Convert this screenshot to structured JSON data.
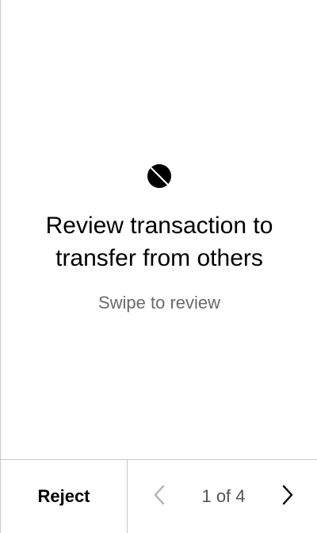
{
  "review": {
    "logo_icon": "ontology-logo-icon",
    "title": "Review transaction to transfer from others",
    "subtitle": "Swipe to review"
  },
  "footer": {
    "reject_label": "Reject",
    "pagination": {
      "text": "1 of 4",
      "current": 1,
      "total": 4,
      "prev_icon": "chevron-left-icon",
      "next_icon": "chevron-right-icon",
      "prev_enabled": false,
      "next_enabled": true
    }
  },
  "colors": {
    "text": "#000000",
    "muted_text": "#6a6a6a",
    "disabled_icon": "#b0b0b0",
    "divider": "#c8c8c8",
    "background": "#ffffff"
  }
}
